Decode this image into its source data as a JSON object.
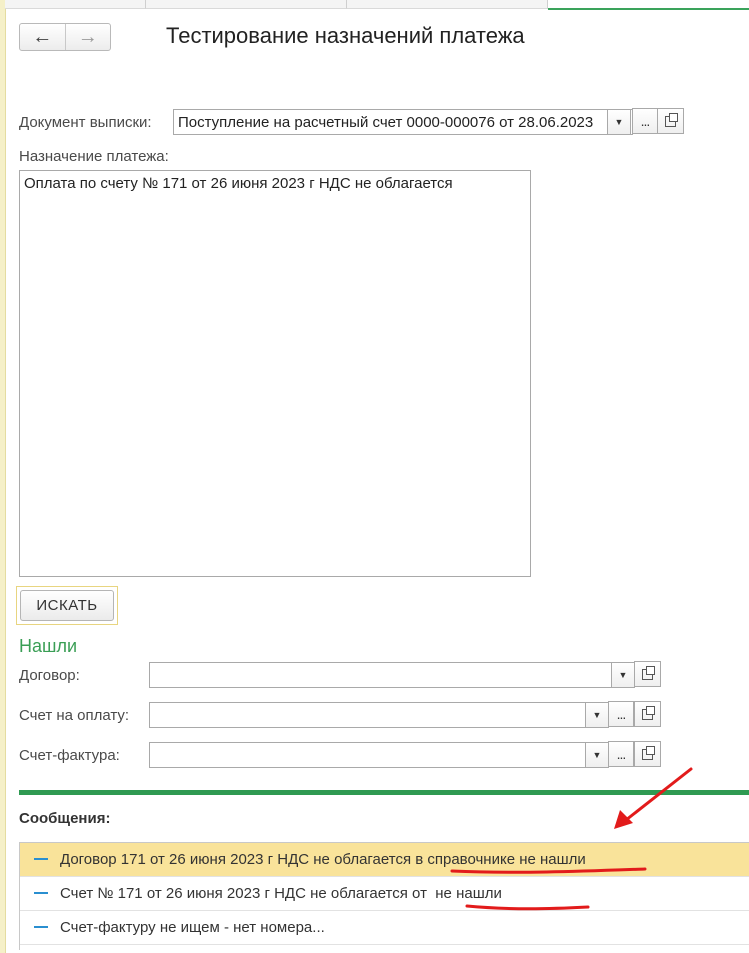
{
  "window": {
    "title": "Тестирование назначений платежа"
  },
  "nav": {
    "back_icon": "←",
    "forward_icon": "→"
  },
  "document_field": {
    "label": "Документ выписки:",
    "value": "Поступление на расчетный счет 0000-000076 от 28.06.2023"
  },
  "purpose": {
    "label": "Назначение платежа:",
    "value": "Оплата по счету № 171 от 26 июня 2023 г НДС не облагается"
  },
  "search_button": {
    "label": "ИСКАТЬ"
  },
  "found": {
    "title": "Нашли",
    "contract_label": "Договор:",
    "contract_value": "",
    "invoice_label": "Счет на оплату:",
    "invoice_value": "",
    "factura_label": "Счет-фактура:",
    "factura_value": ""
  },
  "messages": {
    "title": "Сообщения:",
    "items": [
      "Договор 171 от 26 июня 2023 г НДС не облагается в справочнике не нашли",
      "Счет № 171 от 26 июня 2023 г НДС не облагается от  не нашли",
      "Счет-фактуру не ищем - нет номера..."
    ]
  },
  "button_glyphs": {
    "dropdown": "▼",
    "select": "...",
    "dropdown_icon": "triangle-down-icon",
    "open_icon": "open-form-icon"
  },
  "colors": {
    "accent_green": "#2f9a52",
    "selected_row": "#f9e39a",
    "annotation_red": "#e21b1b",
    "message_dash": "#2a8fd0"
  }
}
